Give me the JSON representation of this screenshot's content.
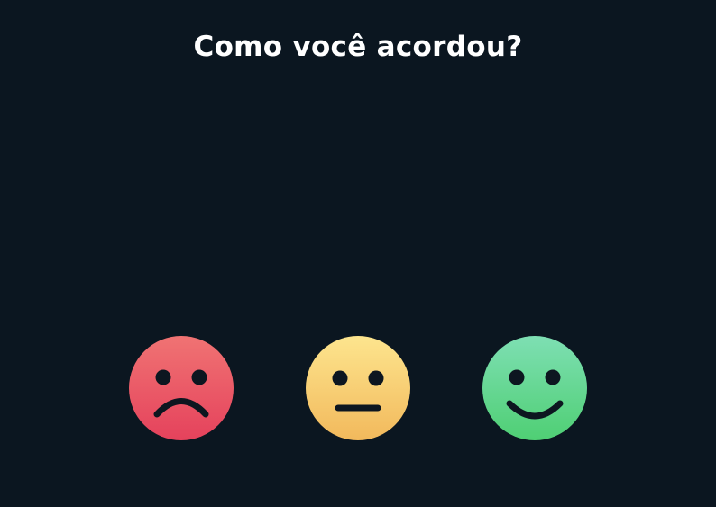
{
  "title": "Como você acordou?",
  "colors": {
    "background": "#0b1620",
    "title_text": "#ffffff",
    "face_features": "#0d1620"
  },
  "faces": [
    {
      "mood": "sad",
      "icon": "sad-face-icon",
      "gradient_top": "#f07373",
      "gradient_bottom": "#e5425c"
    },
    {
      "mood": "neutral",
      "icon": "neutral-face-icon",
      "gradient_top": "#fde58e",
      "gradient_bottom": "#f2b95c"
    },
    {
      "mood": "happy",
      "icon": "happy-face-icon",
      "gradient_top": "#7edfb3",
      "gradient_bottom": "#4fcf74"
    }
  ]
}
